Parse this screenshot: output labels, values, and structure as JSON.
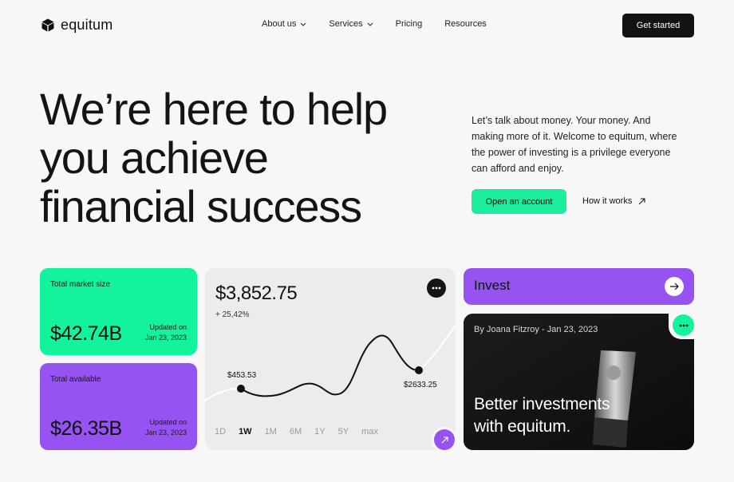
{
  "brand": {
    "name": "equitum"
  },
  "nav": {
    "items": [
      {
        "label": "About us",
        "has_dropdown": true
      },
      {
        "label": "Services",
        "has_dropdown": true
      },
      {
        "label": "Pricing",
        "has_dropdown": false
      },
      {
        "label": "Resources",
        "has_dropdown": false
      }
    ],
    "cta": "Get started"
  },
  "hero": {
    "title_lines": [
      "We’re here to help",
      "you achieve",
      "financial success"
    ],
    "description": "Let’s talk about money. Your money. And making more of it. Welcome to equitum, where the power of investing is a privilege everyone can afford and enjoy.",
    "primary_cta": "Open an account",
    "secondary_cta": "How it works"
  },
  "stats": [
    {
      "label": "Total market size",
      "value": "$42.74B",
      "updated_label": "Updated on",
      "updated_date": "Jan 23, 2023",
      "color": "#13f29c"
    },
    {
      "label": "Total available",
      "value": "$26.35B",
      "updated_label": "Updated on",
      "updated_date": "Jan 23, 2023",
      "color": "#9653f2"
    }
  ],
  "chart": {
    "value": "$3,852.75",
    "change": "+ 25,42%",
    "ranges": [
      "1D",
      "1W",
      "1M",
      "6M",
      "1Y",
      "5Y",
      "max"
    ],
    "active_range": "1W",
    "point_labels": [
      "$453.53",
      "$2633.25"
    ]
  },
  "chart_data": {
    "type": "line",
    "title": "",
    "series": [
      {
        "name": "",
        "values": [
          453.53,
          380,
          520,
          470,
          1400,
          3900,
          2633.25
        ]
      }
    ],
    "highlighted_points": [
      {
        "label": "$453.53",
        "value": 453.53
      },
      {
        "label": "$2633.25",
        "value": 2633.25
      }
    ],
    "grid": false
  },
  "invest": {
    "label": "Invest"
  },
  "article": {
    "meta": "By Joana Fitzroy - Jan 23, 2023",
    "title_lines": [
      "Better investments",
      "with equitum."
    ]
  },
  "colors": {
    "green": "#13f29c",
    "purple": "#9653f2",
    "dark": "#121212",
    "background": "#f7f7f7"
  }
}
